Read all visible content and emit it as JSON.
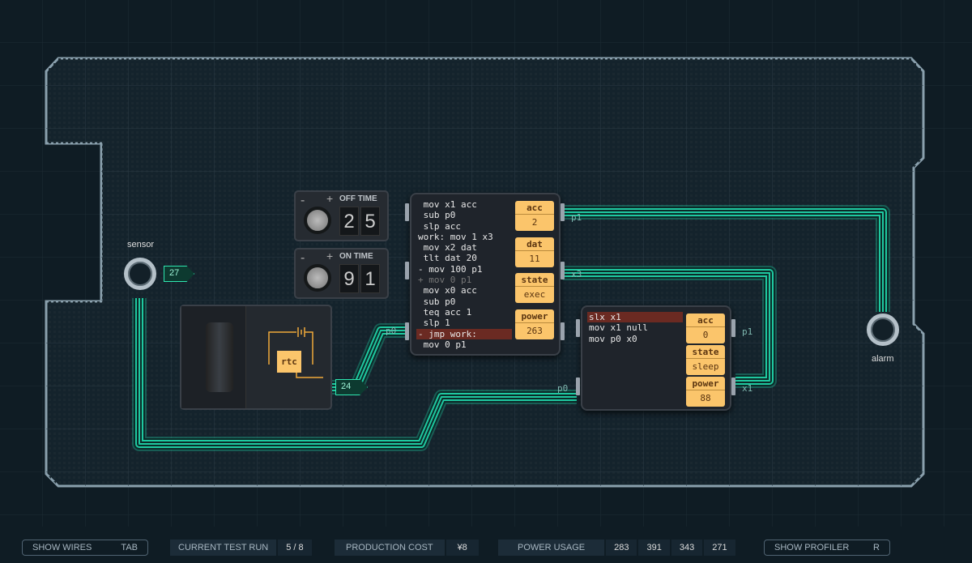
{
  "colors": {
    "wire": "#1fc8a0",
    "register": "#fbc56b",
    "highlight": "#6b2a22",
    "background": "#0f1c24"
  },
  "sensor": {
    "label": "sensor",
    "value": "27",
    "icon": "sensor-ring-icon"
  },
  "alarm": {
    "label": "alarm",
    "icon": "alarm-ring-icon"
  },
  "rtc": {
    "label": "rtc",
    "value": "24",
    "icon": "battery-icon"
  },
  "off_time": {
    "label": "OFF TIME",
    "minus": "-",
    "plus": "+",
    "digits": [
      "2",
      "5"
    ]
  },
  "on_time": {
    "label": "ON TIME",
    "minus": "-",
    "plus": "+",
    "digits": [
      "9",
      "1"
    ]
  },
  "mcu1": {
    "code": [
      " mov x1 acc",
      " sub p0",
      " slp acc",
      "work: mov 1 x3",
      " mov x2 dat",
      " tlt dat 20",
      "- mov 100 p1",
      "+ mov 0 p1",
      " mov x0 acc",
      " sub p0",
      " teq acc 1",
      " slp 1",
      "- jmp work:",
      " mov 0 p1"
    ],
    "highlight_line": 12,
    "dim_line": 7,
    "registers": [
      {
        "name": "acc",
        "value": "2"
      },
      {
        "name": "dat",
        "value": "11"
      },
      {
        "name": "state",
        "value": "exec"
      },
      {
        "name": "power",
        "value": "263"
      }
    ],
    "ports": {
      "p0": "p0",
      "p1": "p1",
      "x3": "x3"
    }
  },
  "mcu2": {
    "code": [
      "slx x1",
      "mov x1 null",
      "mov p0 x0"
    ],
    "highlight_line": 0,
    "registers": [
      {
        "name": "acc",
        "value": "0"
      },
      {
        "name": "state",
        "value": "sleep"
      },
      {
        "name": "power",
        "value": "88"
      }
    ],
    "ports": {
      "p0": "p0",
      "p1": "p1",
      "x1": "x1"
    }
  },
  "bottom_bar": {
    "show_wires": "SHOW WIRES",
    "show_wires_key": "TAB",
    "test_run_label": "CURRENT TEST RUN",
    "test_run_value": "5 / 8",
    "cost_label": "PRODUCTION COST",
    "cost_value": "¥8",
    "power_label": "POWER USAGE",
    "power_values": [
      "283",
      "391",
      "343",
      "271"
    ],
    "show_profiler": "SHOW PROFILER",
    "show_profiler_key": "R"
  }
}
